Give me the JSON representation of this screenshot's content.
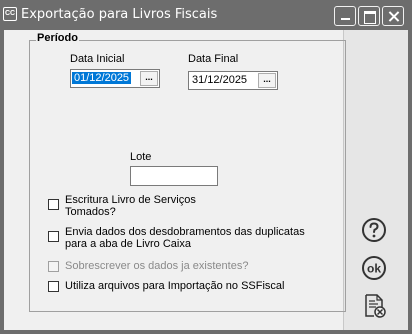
{
  "window": {
    "icon_text": "CC",
    "title": "Exportação para Livros Fiscais"
  },
  "periodo": {
    "group_title": "Período",
    "data_inicial_label": "Data Inicial",
    "data_inicial_value": "01/12/2025",
    "data_final_label": "Data Final",
    "data_final_value": "31/12/2025",
    "picker_label": "..."
  },
  "lote": {
    "label": "Lote",
    "value": ""
  },
  "options": [
    {
      "line1": "Escritura Livro de Serviços",
      "line2": "Tomados?",
      "checked": false,
      "enabled": true
    },
    {
      "line1": "Envia dados dos desdobramentos das duplicatas",
      "line2": "para a aba de Livro Caixa",
      "checked": false,
      "enabled": true
    },
    {
      "line1": "Sobrescrever os dados ja existentes?",
      "line2": "",
      "checked": false,
      "enabled": false
    },
    {
      "line1": "Utiliza arquivos para Importação no SSFiscal",
      "line2": "",
      "checked": false,
      "enabled": true
    }
  ],
  "side_buttons": {
    "help_icon": "question-circle-icon",
    "ok_label": "ok",
    "cancel_icon": "document-cancel-icon"
  },
  "colors": {
    "titlebar": "#6d6d6d",
    "selection": "#0078d7",
    "client": "#f0f0f0"
  }
}
